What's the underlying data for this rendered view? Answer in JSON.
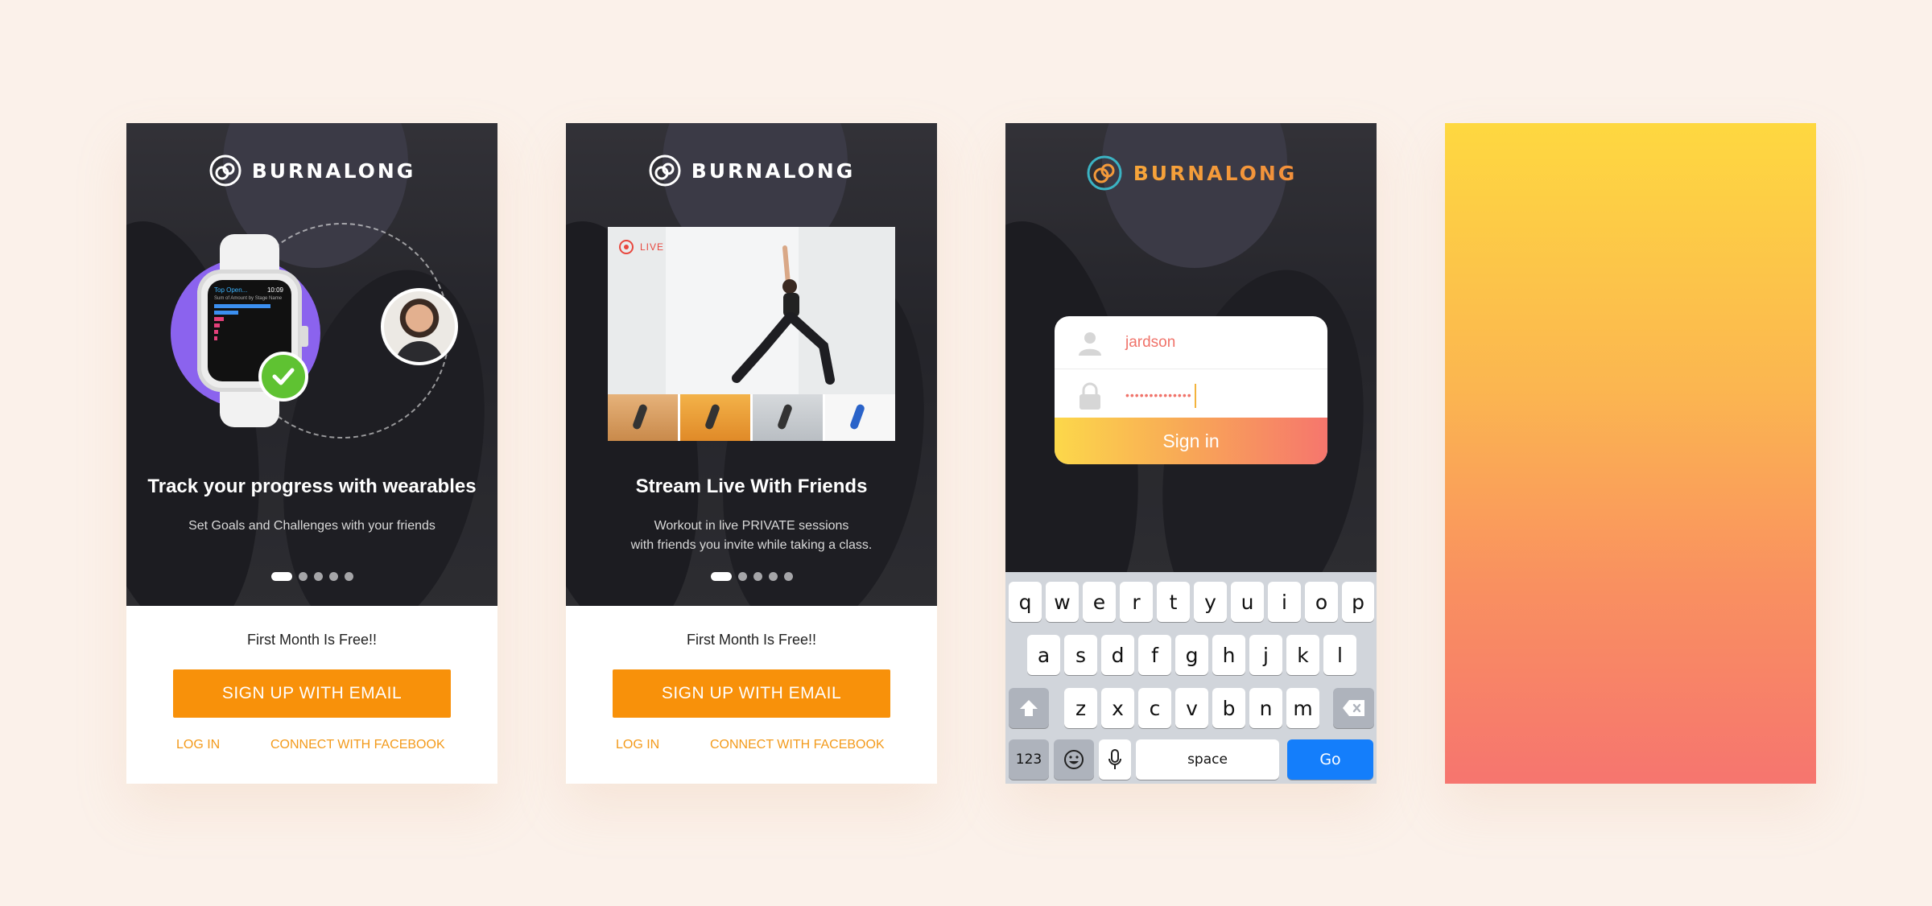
{
  "brand": {
    "name": "BURNALONG",
    "accent": "#f8910a",
    "secondary_accent": "#f0736a"
  },
  "screens": [
    {
      "id": "wearables",
      "headline": "Track your progress with wearables",
      "subline": "Set Goals and Challenges with your friends",
      "watch": {
        "app_title": "Top Open...",
        "time": "10:09",
        "chart_label": "Sum of Amount by Stage Name"
      },
      "pager": {
        "pages": 5,
        "active": 1
      },
      "promo": "First  Month Is Free!!",
      "cta": "SIGN UP WITH EMAIL",
      "login": "LOG IN",
      "facebook": "CONNECT WITH FACEBOOK"
    },
    {
      "id": "stream",
      "live_label": "LIVE",
      "headline": "Stream Live With Friends",
      "subline": "Workout in live PRIVATE sessions\nwith friends  you invite while taking a class.",
      "pager": {
        "pages": 5,
        "active": 1
      },
      "promo": "First  Month Is Free!!",
      "cta": "SIGN UP WITH EMAIL",
      "login": "LOG IN",
      "facebook": "CONNECT WITH FACEBOOK"
    },
    {
      "id": "login",
      "username": "jardson",
      "password_mask": "••••••••••••••",
      "signin": "Sign in",
      "keyboard": {
        "row1": [
          "q",
          "w",
          "e",
          "r",
          "t",
          "y",
          "u",
          "i",
          "o",
          "p"
        ],
        "row2": [
          "a",
          "s",
          "d",
          "f",
          "g",
          "h",
          "j",
          "k",
          "l"
        ],
        "row3": [
          "z",
          "x",
          "c",
          "v",
          "b",
          "n",
          "m"
        ],
        "numbers": "123",
        "space": "space",
        "go": "Go"
      }
    },
    {
      "id": "splash-gradient"
    }
  ]
}
